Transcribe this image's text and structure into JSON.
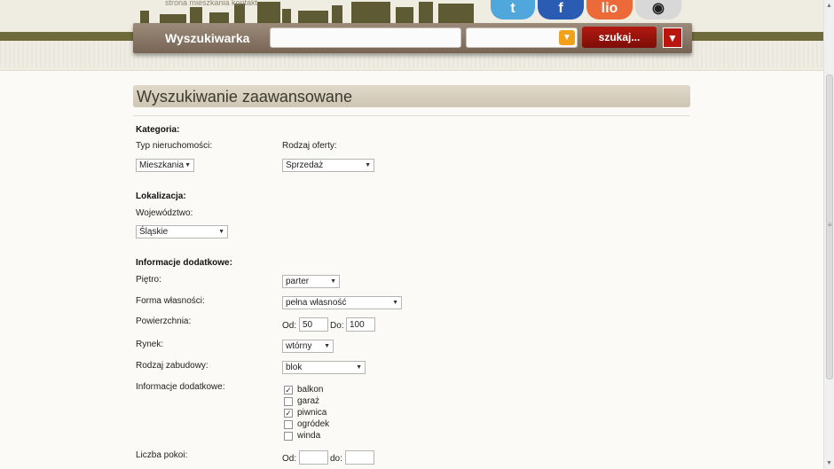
{
  "header": {
    "top_menu_text": "strona mieszkania kontakt",
    "search_title": "Wyszukiwarka",
    "search_input_value": "",
    "search_category_value": "",
    "search_button": "szukaj...",
    "social": [
      {
        "name": "twitter-icon",
        "label": "t",
        "color": "#55a9dd"
      },
      {
        "name": "facebook-icon",
        "label": "f",
        "color": "#2b5fb5"
      },
      {
        "name": "flaker-icon",
        "label": "lio",
        "color": "#ee6a3c"
      },
      {
        "name": "blip-icon",
        "label": "◉",
        "color": "#d9d9d9"
      }
    ]
  },
  "page": {
    "title": "Wyszukiwanie zaawansowane"
  },
  "form": {
    "kategoria": {
      "heading": "Kategoria:",
      "typ_label": "Typ nieruchomości:",
      "typ_value": "Mieszkania",
      "rodzaj_label": "Rodzaj oferty:",
      "rodzaj_value": "Sprzedaż"
    },
    "lokalizacja": {
      "heading": "Lokalizacja:",
      "woj_label": "Województwo:",
      "woj_value": "Śląskie"
    },
    "dodatkowe": {
      "heading": "Informacje dodatkowe:",
      "pietro_label": "Piętro:",
      "pietro_value": "parter",
      "forma_label": "Forma własności:",
      "forma_value": "pełna własność",
      "pow_label": "Powierzchnia:",
      "od_label": "Od:",
      "pow_od": "50",
      "do_label": "Do:",
      "pow_do": "100",
      "rynek_label": "Rynek:",
      "rynek_value": "wtórny",
      "zabudowa_label": "Rodzaj zabudowy:",
      "zabudowa_value": "blok",
      "info_label": "Informacje dodatkowe:",
      "checkboxes": [
        {
          "label": "balkon",
          "checked": true
        },
        {
          "label": "garaż",
          "checked": false
        },
        {
          "label": "piwnica",
          "checked": true
        },
        {
          "label": "ogródek",
          "checked": false
        },
        {
          "label": "winda",
          "checked": false
        }
      ],
      "pokoje_label": "Liczba pokoi:",
      "pokoje_od_label": "Od:",
      "pokoje_od": "",
      "pokoje_do_label": "do:",
      "pokoje_do": ""
    }
  }
}
